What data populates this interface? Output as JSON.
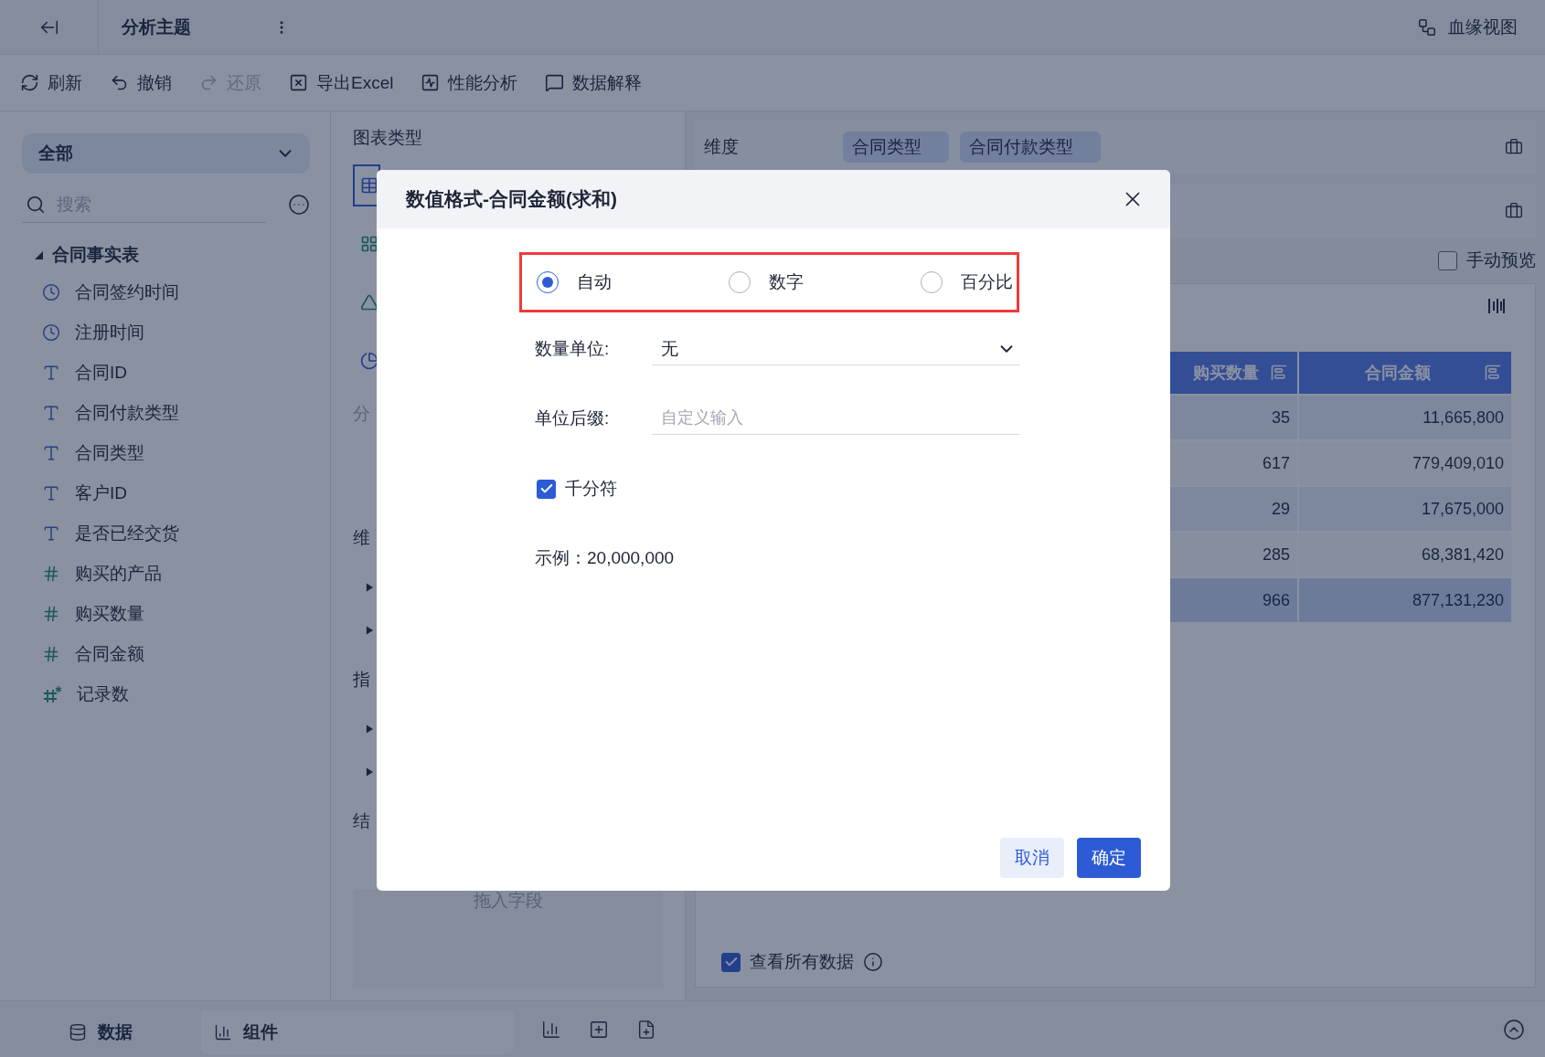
{
  "top_bar": {
    "title": "分析主题",
    "lineage": "血缘视图"
  },
  "toolbar": [
    {
      "label": "刷新",
      "kind": "refresh",
      "disabled": false
    },
    {
      "label": "撤销",
      "kind": "undo",
      "disabled": false
    },
    {
      "label": "还原",
      "kind": "redo",
      "disabled": true
    },
    {
      "label": "导出Excel",
      "kind": "export",
      "disabled": false
    },
    {
      "label": "性能分析",
      "kind": "performance",
      "disabled": false
    },
    {
      "label": "数据解释",
      "kind": "explain",
      "disabled": false
    }
  ],
  "sidebar": {
    "scope": "全部",
    "search": {
      "placeholder": "搜索"
    },
    "tree": [
      {
        "label": "合同事实表",
        "expanded": true,
        "children": [
          {
            "label": "合同签约时间",
            "kind": "time"
          },
          {
            "label": "注册时间",
            "kind": "time"
          },
          {
            "label": "合同ID",
            "kind": "text"
          },
          {
            "label": "合同付款类型",
            "kind": "text"
          },
          {
            "label": "合同类型",
            "kind": "text"
          },
          {
            "label": "客户ID",
            "kind": "text"
          },
          {
            "label": "是否已经交货",
            "kind": "text"
          },
          {
            "label": "购买的产品",
            "kind": "number"
          },
          {
            "label": "购买数量",
            "kind": "number"
          },
          {
            "label": "合同金额",
            "kind": "number"
          },
          {
            "label": "记录数",
            "kind": "count"
          }
        ]
      }
    ]
  },
  "chart_panel": {
    "heading": "图表类型",
    "chart_types": [
      {
        "kind": "table",
        "selected": true
      },
      {
        "kind": "cross",
        "selected": false
      },
      {
        "kind": "funnel",
        "selected": false
      },
      {
        "kind": "pie",
        "selected": false
      }
    ],
    "group_label": "分",
    "dimension_label": "维",
    "dimension_rows": [
      {
        "expanded": false
      },
      {
        "expanded": false
      }
    ],
    "measure_label": "指",
    "measure_rows": [
      {
        "expanded": false
      },
      {
        "expanded": false
      }
    ],
    "result_label": "结",
    "drop_hint": "拖入字段"
  },
  "config_panel": {
    "dimension": {
      "label": "维度",
      "tags": [
        "合同类型",
        "合同付款类型"
      ]
    },
    "manual_preview": {
      "label": "手动预览",
      "checked": false
    },
    "table": {
      "columns": [
        {
          "label": "购买数量"
        },
        {
          "label": "合同金额"
        }
      ],
      "rows": [
        {
          "kind": "data",
          "cells": [
            "35",
            "11,665,800"
          ]
        },
        {
          "kind": "data",
          "cells": [
            "617",
            "779,409,010"
          ]
        },
        {
          "kind": "data",
          "cells": [
            "29",
            "17,675,000"
          ]
        },
        {
          "kind": "data",
          "cells": [
            "285",
            "68,381,420"
          ]
        },
        {
          "kind": "total",
          "cells": [
            "966",
            "877,131,230"
          ]
        }
      ]
    },
    "view_all": {
      "label": "查看所有数据",
      "checked": true
    }
  },
  "bottom_bar": {
    "tabs": [
      {
        "label": "数据",
        "kind": "data",
        "selected": false
      },
      {
        "label": "组件",
        "kind": "component",
        "selected": true
      }
    ]
  },
  "dialog": {
    "title": "数值格式-合同金额(求和)",
    "format_options": [
      {
        "label": "自动",
        "selected": true
      },
      {
        "label": "数字",
        "selected": false
      },
      {
        "label": "百分比",
        "selected": false
      }
    ],
    "unit": {
      "label": "数量单位:",
      "value": "无"
    },
    "suffix": {
      "label": "单位后缀:",
      "placeholder": "自定义输入"
    },
    "thousands": {
      "label": "千分符",
      "checked": true
    },
    "example": "示例：20,000,000",
    "buttons": [
      {
        "label": "取消",
        "kind": "secondary"
      },
      {
        "label": "确定",
        "kind": "primary"
      }
    ]
  }
}
